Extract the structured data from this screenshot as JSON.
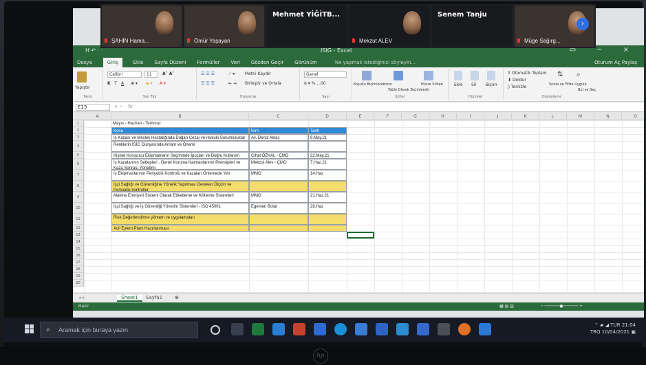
{
  "zoom": {
    "participants": [
      {
        "name": "ŞAHİN Hama...",
        "style": "r"
      },
      {
        "name": "Ömür Yaşayan",
        "style": "r"
      },
      {
        "name": "Mehmet YİĞİTB...",
        "style": "b",
        "big": true
      },
      {
        "name": "Mekzut ALEV",
        "style": "b"
      },
      {
        "name": "Senem Tanju",
        "style": "b",
        "big": true
      },
      {
        "name": "Müge Sağırg...",
        "style": "r"
      }
    ]
  },
  "excel": {
    "title": "İSİG - Excel",
    "quick_access": "H  ↶ ·  ·",
    "tabs": [
      "Dosya",
      "Giriş",
      "Ekle",
      "Sayfa Düzeni",
      "Formüller",
      "Veri",
      "Gözden Geçir",
      "Görünüm"
    ],
    "active_tab": "Giriş",
    "tell_me": "Ne yapmak istediğinizi söyleyin...",
    "account": "Oturum Aç   Paylaş",
    "ribbon": {
      "paste": "Yapıştır",
      "font_name": "Calibri",
      "font_size": "11",
      "wrap_text": "Metni Kaydır",
      "merge_center": "Birleştir ve Ortala",
      "number_format": "Genel",
      "conditional_format": "Koşullu Biçimlendirme",
      "format_table": "Tablo Olarak Biçimlendir",
      "cell_styles": "Hücre Stilleri",
      "insert": "Ekle",
      "delete": "Sil",
      "format": "Biçim",
      "autosum": "Otomatik Toplam",
      "fill": "Doldur",
      "clear": "Temizle",
      "sort_filter": "Sırala ve Filtre Uygula",
      "find_select": "Bul ve Seç",
      "groups": [
        "Pano",
        "Yazı Tipi",
        "Hizalama",
        "Sayı",
        "Stiller",
        "Hücreler",
        "Düzenleme"
      ]
    },
    "name_box": "E13",
    "formula_fx": "fx",
    "columns": [
      "A",
      "B",
      "C",
      "D",
      "E",
      "F",
      "G",
      "H",
      "I",
      "J",
      "K",
      "L",
      "M",
      "N",
      "O"
    ],
    "sheet": {
      "title": "Mayıs - Haziran - Temmuz",
      "headers": [
        "Konu",
        "İsim",
        "Tarih"
      ],
      "rows": [
        {
          "topic": "İş Kazası ve Meslek Hastalığında Doğan Cezai ve Hukuki Sorumluluklar",
          "name": "Av. Deniz Aktaş",
          "date": "8.May.21",
          "style": ""
        },
        {
          "topic": "Renklerin İSİG Dünyasında Anlam ve Önemi",
          "name": "",
          "date": "",
          "style": ""
        },
        {
          "topic": "Kişisel Koruyucu Ekipmanların Seçiminde İpuçları ve Doğru Kullanım",
          "name": "Cihat ÖZKAL - ÇMO",
          "date": "22.May.21",
          "style": ""
        },
        {
          "topic": "İş Kazalarının Sebepleri , Genel Koruma Katmanlarının Prensipleri ve Kaza Sonrası Yönetimi",
          "name": "Mekzut Alev - ÇMO",
          "date": "7.Haz.21",
          "style": ""
        },
        {
          "topic": "İş Ekipmanlarının Periyodik Kontrolü ve Kazaları Önlemede Yeri",
          "name": "MMO",
          "date": "14.Haz",
          "style": ""
        },
        {
          "topic": "İşçi Sağlığı ve Güvenliğine Yönelik Yapılması Gereken Ölçüm ve Periyodik kontroller",
          "name": "",
          "date": "",
          "style": "yel"
        },
        {
          "topic": "Makine Emniyeti Sistemi Olarak Etiketleme ve Kilitleme Sistemleri",
          "name": "MMO",
          "date": "21.Haz.21",
          "style": ""
        },
        {
          "topic": "İşçi Sağlığı ve İş Güvenliği Yönetim Sistemleri - ISO 45001",
          "name": "Egemen Bolat",
          "date": "28.Haz",
          "style": ""
        },
        {
          "topic": "Risk Değerlendirme yöntem ve uygulamaları",
          "name": "",
          "date": "",
          "style": "yel"
        },
        {
          "topic": "Acil Eylem Planı Hazırlanması",
          "name": "",
          "date": "",
          "style": "yel"
        }
      ]
    },
    "sheet_tabs": [
      "Sheet1",
      "Sayfa1"
    ],
    "active_sheet": "Sheet1",
    "status_left": "Hazır"
  },
  "taskbar": {
    "search_placeholder": "Aramak için buraya yazın",
    "weather": "TUR",
    "lang": "TRQ",
    "time": "21:04",
    "date": "10/04/2021"
  }
}
